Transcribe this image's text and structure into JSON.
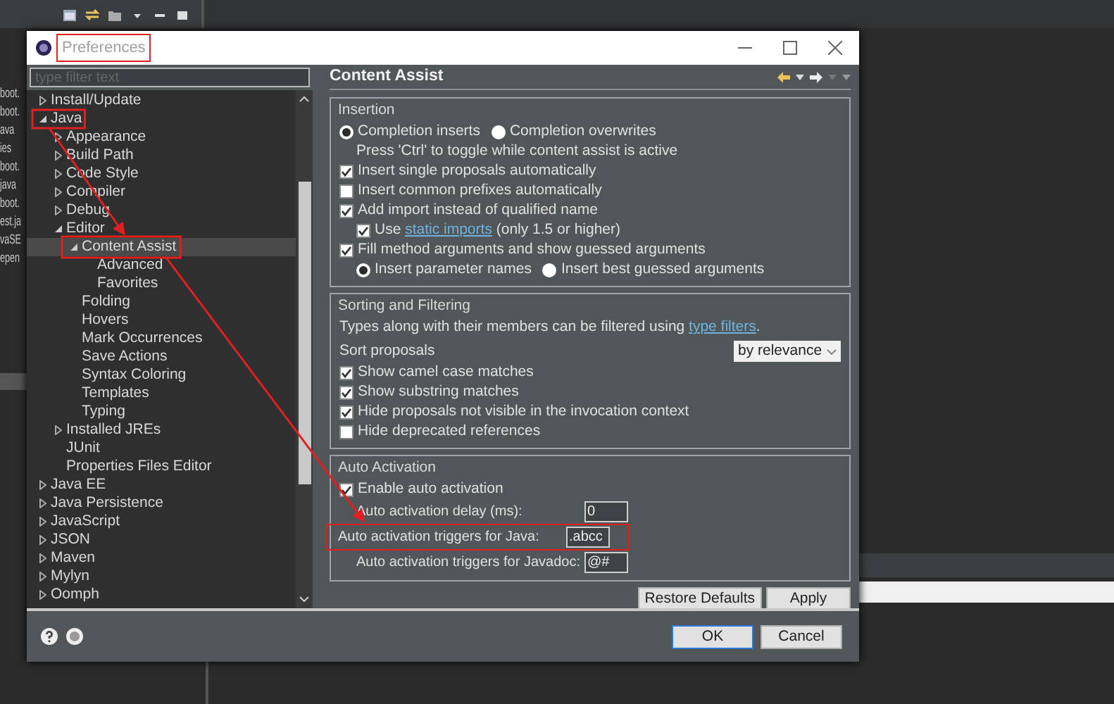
{
  "window": {
    "title": "Preferences"
  },
  "background_editor": {
    "fragments": [
      "boot.",
      "boot.",
      "ava",
      "ies",
      "boot.",
      "java",
      "boot.",
      "est.ja",
      "vaSE",
      "epen"
    ]
  },
  "filter": {
    "placeholder": "type filter text"
  },
  "tree": [
    {
      "label": "Install/Update",
      "expanded": false,
      "selected": false
    },
    {
      "label": "Java",
      "expanded": true,
      "selected": false,
      "children": [
        {
          "label": "Appearance",
          "expanded": false,
          "selected": false
        },
        {
          "label": "Build Path",
          "expanded": false,
          "selected": false
        },
        {
          "label": "Code Style",
          "expanded": false,
          "selected": false
        },
        {
          "label": "Compiler",
          "expanded": false,
          "selected": false
        },
        {
          "label": "Debug",
          "expanded": false,
          "selected": false
        },
        {
          "label": "Editor",
          "expanded": true,
          "selected": false,
          "children": [
            {
              "label": "Content Assist",
              "expanded": true,
              "selected": true,
              "children": [
                {
                  "label": "Advanced",
                  "selected": false
                },
                {
                  "label": "Favorites",
                  "selected": false
                }
              ]
            },
            {
              "label": "Folding",
              "selected": false
            },
            {
              "label": "Hovers",
              "selected": false
            },
            {
              "label": "Mark Occurrences",
              "selected": false
            },
            {
              "label": "Save Actions",
              "selected": false
            },
            {
              "label": "Syntax Coloring",
              "selected": false
            },
            {
              "label": "Templates",
              "selected": false
            },
            {
              "label": "Typing",
              "selected": false
            }
          ]
        },
        {
          "label": "Installed JREs",
          "expanded": false,
          "selected": false
        },
        {
          "label": "JUnit",
          "selected": false
        },
        {
          "label": "Properties Files Editor",
          "selected": false
        }
      ]
    },
    {
      "label": "Java EE",
      "expanded": false,
      "selected": false
    },
    {
      "label": "Java Persistence",
      "expanded": false,
      "selected": false
    },
    {
      "label": "JavaScript",
      "expanded": false,
      "selected": false
    },
    {
      "label": "JSON",
      "expanded": false,
      "selected": false
    },
    {
      "label": "Maven",
      "expanded": false,
      "selected": false
    },
    {
      "label": "Mylyn",
      "expanded": false,
      "selected": false
    },
    {
      "label": "Oomph",
      "expanded": false,
      "selected": false
    }
  ],
  "page": {
    "title": "Content Assist",
    "groups": [
      {
        "title": "Insertion",
        "rows": [
          {
            "kind": "radios",
            "options": [
              {
                "label": "Completion inserts",
                "selected": true
              },
              {
                "label": "Completion overwrites",
                "selected": false
              }
            ]
          },
          {
            "kind": "note",
            "text": "Press 'Ctrl' to toggle while content assist is active"
          },
          {
            "kind": "checkbox",
            "label": "Insert single proposals automatically",
            "checked": true
          },
          {
            "kind": "checkbox",
            "label": "Insert common prefixes automatically",
            "checked": false
          },
          {
            "kind": "checkbox",
            "label": "Add import instead of qualified name",
            "checked": true,
            "children": [
              {
                "kind": "checkbox",
                "label": "Use ",
                "link": "static imports",
                "after": " (only 1.5 or higher)",
                "checked": true
              }
            ]
          },
          {
            "kind": "checkbox",
            "label": "Fill method arguments and show guessed arguments",
            "checked": true,
            "children": [
              {
                "kind": "radios",
                "options": [
                  {
                    "label": "Insert parameter names",
                    "selected": true
                  },
                  {
                    "label": "Insert best guessed arguments",
                    "selected": false
                  }
                ]
              }
            ]
          }
        ]
      },
      {
        "title": "Sorting and Filtering",
        "rows": [
          {
            "kind": "text",
            "text": "Types along with their members can be filtered using ",
            "link": "type filters",
            "after": "."
          },
          {
            "kind": "select",
            "label": "Sort proposals",
            "value": "by relevance"
          },
          {
            "kind": "checkbox",
            "label": "Show camel case matches",
            "checked": true
          },
          {
            "kind": "checkbox",
            "label": "Show substring matches",
            "checked": true
          },
          {
            "kind": "checkbox",
            "label": "Hide proposals not visible in the invocation context",
            "checked": true
          },
          {
            "kind": "checkbox",
            "label": "Hide deprecated references",
            "checked": false
          }
        ]
      },
      {
        "title": "Auto Activation",
        "rows": [
          {
            "kind": "checkbox",
            "label": "Enable auto activation",
            "checked": true
          },
          {
            "kind": "field",
            "label": "Auto activation delay (ms):",
            "value": "0"
          },
          {
            "kind": "field",
            "label": "Auto activation triggers for Java:",
            "value": ".abcc"
          },
          {
            "kind": "field",
            "label": "Auto activation triggers for Javadoc:",
            "value": "@#"
          }
        ]
      }
    ]
  },
  "page_buttons": [
    "Restore Defaults",
    "Apply"
  ],
  "dialog_buttons": [
    {
      "label": "OK",
      "default": true
    },
    {
      "label": "Cancel",
      "default": false
    }
  ]
}
